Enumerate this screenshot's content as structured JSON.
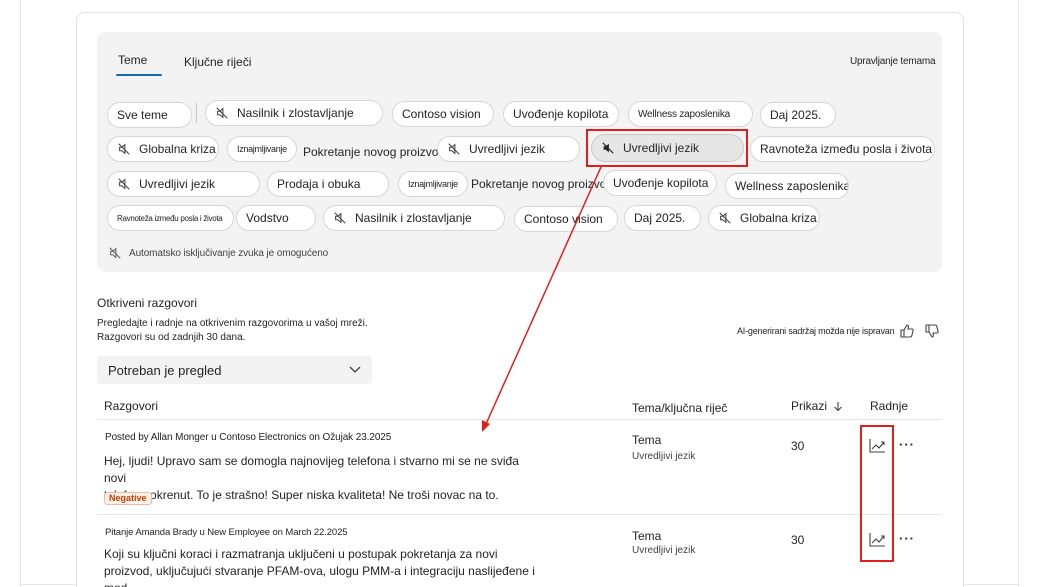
{
  "tabs": {
    "topics": "Teme",
    "keywords": "Ključne riječi",
    "manage": "Upravljanje temama"
  },
  "pills": [
    {
      "label": "Sve teme",
      "muted": false
    },
    {
      "label": "Nasilnik i zlostavljanje",
      "muted": true
    },
    {
      "label": "Contoso vision",
      "muted": false
    },
    {
      "label": "Uvođenje kopilota",
      "muted": false
    },
    {
      "label": "Wellness zaposlenika",
      "muted": false
    },
    {
      "label": "Daj 2025.",
      "muted": false
    },
    {
      "label": "Globalna kriza",
      "muted": true
    },
    {
      "label": "Iznajmljivanje",
      "muted": false
    },
    {
      "label": "Pokretanje novog proizvoda",
      "muted": false
    },
    {
      "label": "Uvredljivi jezik",
      "muted": true
    },
    {
      "label": "Uvredljivi jezik",
      "muted": true,
      "active": true
    },
    {
      "label": "Ravnoteža između posla i života",
      "muted": false
    },
    {
      "label": "Uvredljivi jezik",
      "muted": true
    },
    {
      "label": "Prodaja i obuka",
      "muted": false
    },
    {
      "label": "Iznajmljivanje",
      "muted": false
    },
    {
      "label": "Pokretanje novog proizvoda",
      "muted": false
    },
    {
      "label": "Uvođenje kopilota",
      "muted": false
    },
    {
      "label": "Wellness zaposlenika",
      "muted": false
    },
    {
      "label": "Ravnoteža između posla i života",
      "muted": false
    },
    {
      "label": "Vodstvo",
      "muted": false
    },
    {
      "label": "Nasilnik i zlostavljanje",
      "muted": true
    },
    {
      "label": "Contoso vision",
      "muted": false
    },
    {
      "label": "Daj 2025.",
      "muted": false
    },
    {
      "label": "Globalna kriza",
      "muted": true
    }
  ],
  "automute": "Automatsko isključivanje zvuka je omogućeno",
  "section": {
    "title": "Otkriveni razgovori",
    "desc_line1": "Pregledajte i radnje na otkrivenim razgovorima u vašoj mreži.",
    "desc_line2": "Razgovori su od zadnjih 30 dana.",
    "ai_note": "AI-generirani sadržaj možda nije ispravan"
  },
  "filter": {
    "selected": "Potreban je pregled"
  },
  "table": {
    "headers": {
      "conversations": "Razgovori",
      "topic": "Tema/ključna riječ",
      "views": "Prikazi",
      "actions": "Radnje"
    },
    "rows": [
      {
        "meta": "Posted by Allan Monger u Contoso Electronics on Ožujak 23.2025",
        "line1": "Hej, ljudi! Upravo sam se domogla najnovijeg telefona i stvarno mi se ne sviđa novi",
        "line2": "telefon pokrenut. To je strašno! Super niska kvaliteta! Ne troši novac na to.",
        "badge": "Negative",
        "topic_type": "Tema",
        "topic_name": "Uvredljivi jezik",
        "views": "30"
      },
      {
        "meta": "Pitanje Amanda Brady u New Employee on March 22.2025",
        "line1": "Koji su ključni koraci i razmatranja uključeni u postupak pokretanja za novi",
        "line2": "proizvod, uključujući stvaranje PFAM-ova, ulogu PMM-a i integraciju naslijeđene i mod ...",
        "topic_type": "Tema",
        "topic_name": "Uvredljivi jezik",
        "views": "30"
      }
    ]
  },
  "colors": {
    "accent": "#0f6cbd",
    "highlight": "#e01e1e",
    "badge_text": "#c43e00"
  },
  "icons": {
    "muted": "speaker-muted-icon",
    "trend": "trend-icon",
    "more": "more-icon",
    "thumbs": [
      "thumbs-up-icon",
      "thumbs-down-icon"
    ]
  }
}
